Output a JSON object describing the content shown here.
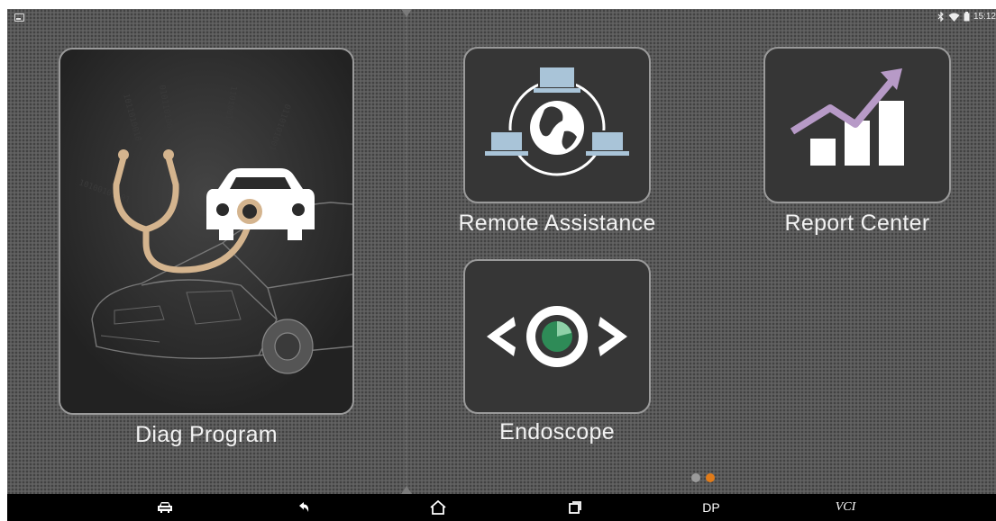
{
  "status_bar": {
    "time": "15:12",
    "icons": [
      "notification-icon",
      "bluetooth-icon",
      "wifi-icon",
      "battery-icon"
    ]
  },
  "apps": {
    "diag_program": {
      "label": "Diag Program",
      "icon": "stethoscope-car-icon"
    },
    "remote_assistance": {
      "label": "Remote Assistance",
      "icon": "network-globe-icon"
    },
    "report_center": {
      "label": "Report Center",
      "icon": "growth-chart-icon"
    },
    "endoscope": {
      "label": "Endoscope",
      "icon": "eye-icon"
    }
  },
  "pager": {
    "current_page": 2,
    "total_pages": 2
  },
  "nav_bar": {
    "items": [
      {
        "name": "car-icon"
      },
      {
        "name": "back-icon"
      },
      {
        "name": "home-icon"
      },
      {
        "name": "recent-apps-icon"
      },
      {
        "label": "DP"
      },
      {
        "label": "VCI"
      }
    ]
  },
  "colors": {
    "background": "#5a5a5a",
    "tile": "#363636",
    "tile_border": "#9a9a9a",
    "stethoscope": "#d4b48e",
    "arrow": "#b79ac7",
    "network": "#a9c4d8",
    "eye_iris": "#2e8b57",
    "dot_active": "#e07b1a",
    "dot_inactive": "#9a9a9a"
  }
}
